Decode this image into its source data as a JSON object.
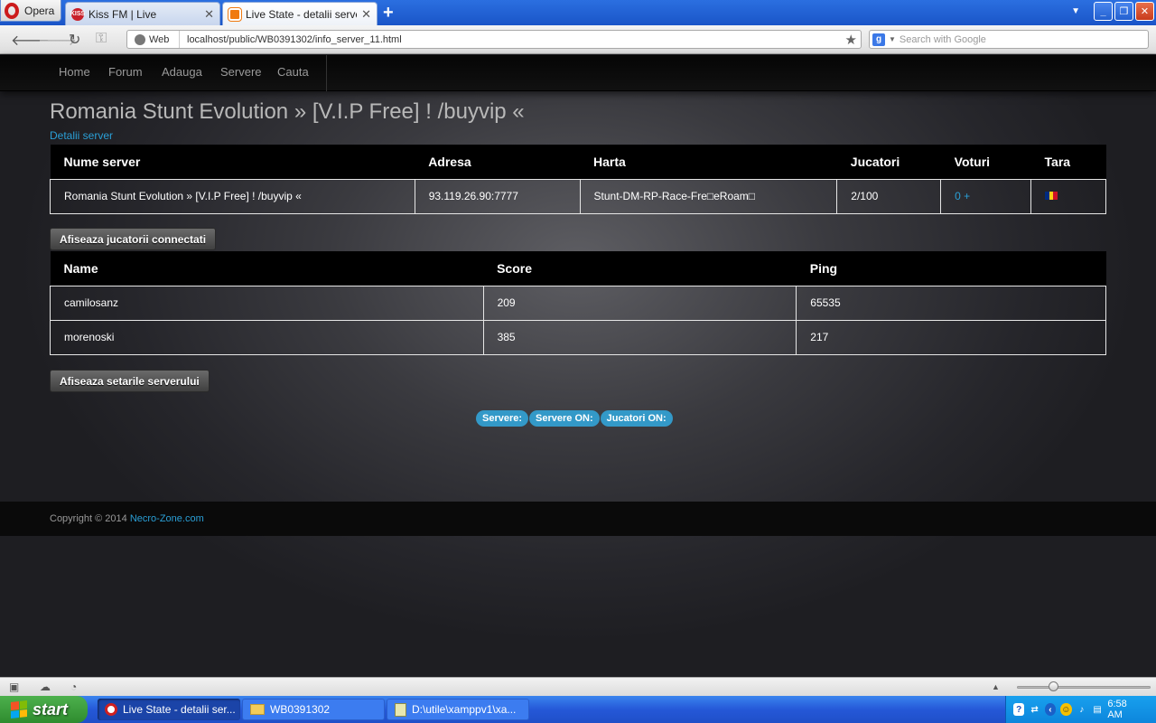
{
  "browser": {
    "menu_label": "Opera",
    "tabs": [
      {
        "label": "Kiss FM | Live",
        "active": false
      },
      {
        "label": "Live State - detalii server",
        "active": true
      }
    ],
    "address": {
      "mode_label": "Web",
      "url": "localhost/public/WB0391302/info_server_11.html",
      "search_placeholder": "Search with Google"
    }
  },
  "site": {
    "nav": [
      "Home",
      "Forum",
      "Adauga",
      "Servere",
      "Cauta"
    ],
    "title": "Romania Stunt Evolution » [V.I.P Free] ! /buyvip «",
    "subtitle": "Detalii server",
    "server_table": {
      "headers": [
        "Nume server",
        "Adresa",
        "Harta",
        "Jucatori",
        "Voturi",
        "Tara"
      ],
      "row": {
        "name": "Romania Stunt Evolution » [V.I.P Free] ! /buyvip «",
        "address": "93.119.26.90:7777",
        "map": "Stunt-DM-RP-Race-Fre□eRoam□",
        "players": "2/100",
        "votes": "0 +",
        "country_flag_colors": [
          "#002b7f",
          "#fcd116",
          "#ce1126"
        ]
      }
    },
    "show_players_button": "Afiseaza jucatorii connectati",
    "players_table": {
      "headers": [
        "Name",
        "Score",
        "Ping"
      ],
      "rows": [
        {
          "name": "camilosanz",
          "score": "209",
          "ping": "65535"
        },
        {
          "name": "morenoski",
          "score": "385",
          "ping": "217"
        }
      ]
    },
    "show_settings_button": "Afiseaza setarile serverului",
    "stats": [
      "Servere:",
      "Servere ON:",
      "Jucatori ON:"
    ],
    "footer": {
      "prefix": "Copyright © 2014 ",
      "link": "Necro-Zone.com"
    },
    "colors": {
      "accent": "#2a9fd6",
      "badge": "#3399c8"
    }
  },
  "taskbar": {
    "start_label": "start",
    "tasks": [
      {
        "label": "Live State - detalii ser...",
        "icon": "opera-icon"
      },
      {
        "label": "WB0391302",
        "icon": "folder-icon"
      },
      {
        "label": "D:\\utile\\xamppv1\\xa...",
        "icon": "notepad-icon"
      }
    ],
    "clock": "6:58 AM"
  }
}
